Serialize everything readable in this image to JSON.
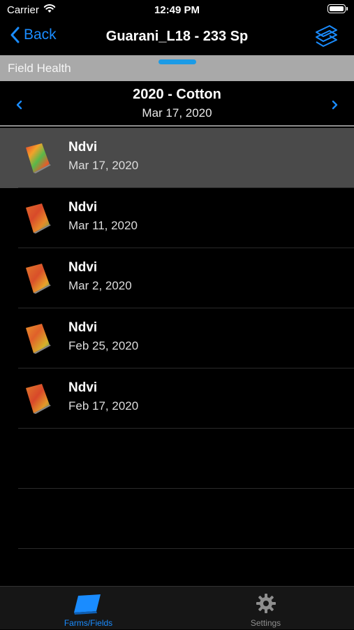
{
  "status_bar": {
    "carrier": "Carrier",
    "time": "12:49 PM"
  },
  "nav": {
    "back_label": "Back",
    "title": "Guarani_L18 - 233 Sp",
    "layers_icon": "layers-icon"
  },
  "band": {
    "label": "Field Health"
  },
  "season": {
    "name": "2020 - Cotton",
    "date": "Mar 17, 2020"
  },
  "images": [
    {
      "title": "Ndvi",
      "date": "Mar 17, 2020",
      "selected": true
    },
    {
      "title": "Ndvi",
      "date": "Mar 11, 2020",
      "selected": false
    },
    {
      "title": "Ndvi",
      "date": "Mar 2, 2020",
      "selected": false
    },
    {
      "title": "Ndvi",
      "date": "Feb 25, 2020",
      "selected": false
    },
    {
      "title": "Ndvi",
      "date": "Feb 17, 2020",
      "selected": false
    }
  ],
  "tabs": [
    {
      "label": "Farms/Fields",
      "icon": "farms-fields-icon",
      "active": true
    },
    {
      "label": "Settings",
      "icon": "gear-icon",
      "active": false
    }
  ],
  "colors": {
    "accent": "#1a8cff",
    "handle": "#1b9be6",
    "band": "#a9a9a9",
    "selected_row": "#4a4a4a"
  }
}
